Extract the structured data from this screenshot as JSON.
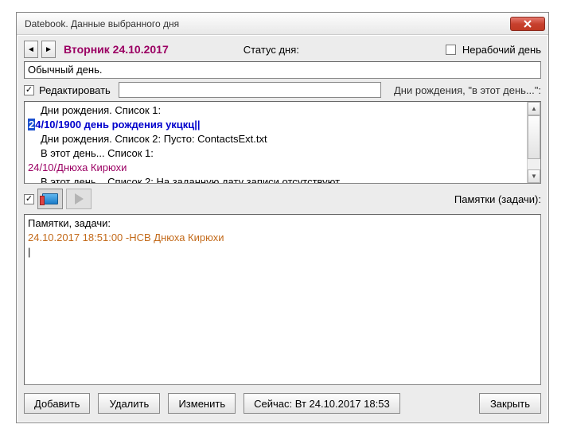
{
  "window": {
    "title": "Datebook. Данные выбранного дня"
  },
  "header": {
    "date": "Вторник 24.10.2017",
    "status_label": "Статус дня:",
    "non_working_label": "Нерабочий день",
    "non_working_checked": false
  },
  "day_desc": {
    "value": "Обычный день."
  },
  "edit": {
    "label": "Редактировать",
    "checked": true,
    "field_value": ""
  },
  "birthdays_label": "Дни рождения, \"в этот день...\":",
  "events": {
    "l1": "Дни рождения. Список 1:",
    "l2_hi": "2",
    "l2_rest": "4/10/1900 день рождения укцкц||",
    "l3": "Дни рождения. Список 2:   Пусто: ContactsExt.txt",
    "l4": "В этот день...  Список 1:",
    "l5": "24/10/Днюха Кирюхи",
    "l6": "В этот день...  Список 2:    На заданную дату записи отсутствуют"
  },
  "memo": {
    "label": "Памятки (задачи):",
    "checked": true
  },
  "notes": {
    "l1": "Памятки, задачи:",
    "l2": "24.10.2017  18:51:00  -НСВ  Днюха Кирюхи",
    "l3": "|"
  },
  "buttons": {
    "add": "Добавить",
    "delete": "Удалить",
    "edit": "Изменить",
    "now": "Сейчас:  Вт  24.10.2017  18:53",
    "close": "Закрыть"
  },
  "icons": {
    "nav_prev": "◄",
    "nav_next": "►",
    "scroll_up": "▲",
    "scroll_down": "▼"
  }
}
